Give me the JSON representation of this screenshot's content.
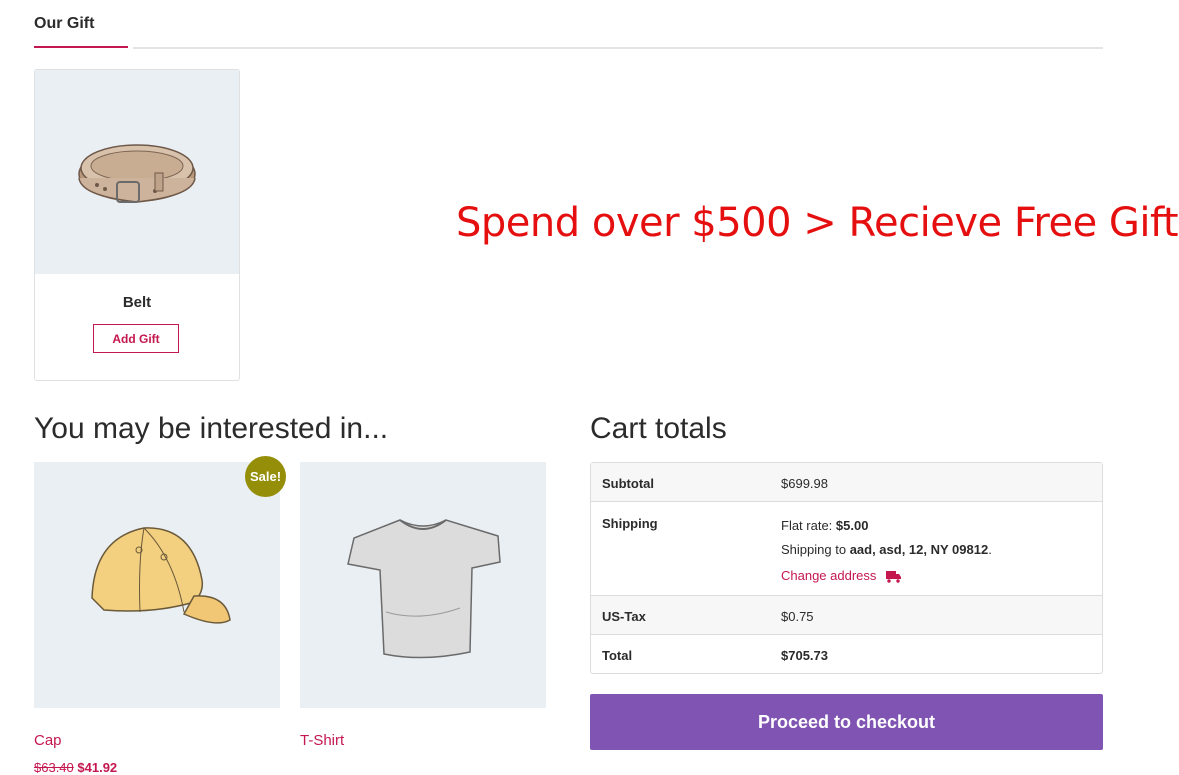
{
  "gift_tab": {
    "label": "Our Gift"
  },
  "gift": {
    "name": "Belt",
    "button": "Add Gift"
  },
  "promo_text": "Spend over $500 > Recieve Free Gift",
  "related": {
    "title": "You may be interested in...",
    "products": [
      {
        "name": "Cap",
        "old_price": "$63.40",
        "price": "$41.92",
        "sale_badge": "Sale!",
        "icon": "cap-image"
      },
      {
        "name": "T-Shirt",
        "icon": "tshirt-image"
      }
    ]
  },
  "cart": {
    "title": "Cart totals",
    "subtotal_label": "Subtotal",
    "subtotal_value": "$699.98",
    "shipping_label": "Shipping",
    "flat_rate_label": "Flat rate:",
    "flat_rate_value": "$5.00",
    "ship_to_label": "Shipping to",
    "ship_to_address": "aad, asd, 12, NY 09812",
    "change_address": "Change address",
    "tax_label": "US-Tax",
    "tax_value": "$0.75",
    "total_label": "Total",
    "total_value": "$705.73",
    "checkout_button": "Proceed to checkout"
  },
  "colors": {
    "accent": "#c4174f",
    "checkout": "#7f54b3",
    "promo": "#e50f0f",
    "sale": "#958e09"
  }
}
